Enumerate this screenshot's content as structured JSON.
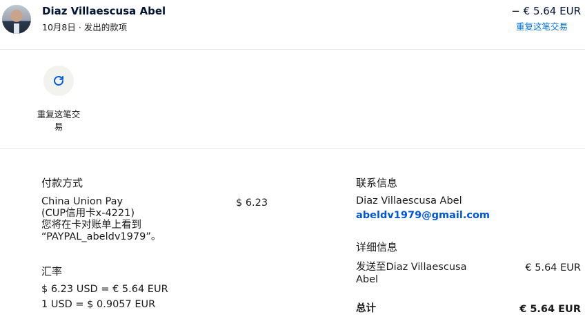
{
  "header": {
    "name": "Diaz Villaescusa Abel",
    "meta": "10月8日 · 发出的款项",
    "amount": "− € 5.64 EUR",
    "repeat_link": "重复这笔交易"
  },
  "action": {
    "icon": "refresh-icon",
    "label": "重复这笔交易"
  },
  "payment": {
    "title": "付款方式",
    "method_lines": [
      "China Union Pay",
      "(CUP信用卡x-4221)",
      "您将在卡对账单上看到",
      "“PAYPAL_abeldv1979”。"
    ],
    "amount": "$ 6.23"
  },
  "exchange": {
    "title": "汇率",
    "line1": "$ 6.23 USD = € 5.64 EUR",
    "line2": "1 USD = $ 0.9057 EUR"
  },
  "contact": {
    "title": "联系信息",
    "name": "Diaz Villaescusa Abel",
    "email": "abeldv1979@gmail.com"
  },
  "details": {
    "title": "详细信息",
    "sent_to_line1": "发送至Diaz Villaescusa",
    "sent_to_line2": "Abel",
    "sent_amount": "€ 5.64 EUR",
    "total_label": "总计",
    "total_amount": "€ 5.64 EUR"
  },
  "colors": {
    "link": "#0070e0",
    "icon": "#0057d8",
    "text": "#1a1a1a"
  }
}
